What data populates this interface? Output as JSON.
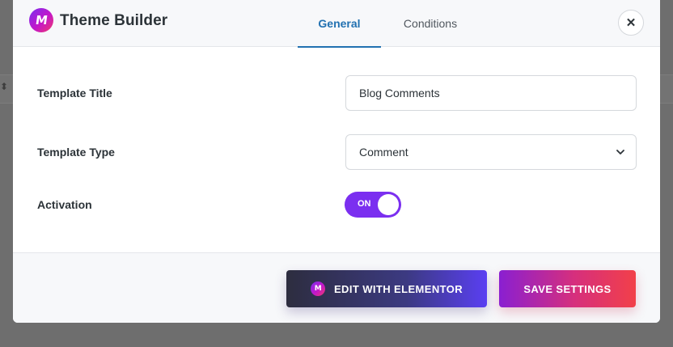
{
  "modal": {
    "title": "Theme Builder",
    "logo_letter": "M",
    "close_symbol": "✕"
  },
  "tabs": [
    {
      "label": "General",
      "active": true
    },
    {
      "label": "Conditions",
      "active": false
    }
  ],
  "form": {
    "template_title": {
      "label": "Template Title",
      "value": "Blog Comments"
    },
    "template_type": {
      "label": "Template Type",
      "selected": "Comment"
    },
    "activation": {
      "label": "Activation",
      "state_text": "ON",
      "enabled": true
    }
  },
  "footer": {
    "edit_label": "EDIT WITH ELEMENTOR",
    "save_label": "SAVE SETTINGS"
  },
  "colors": {
    "accent": "#2271b1",
    "toggle": "#7b2ff0",
    "brand_gradient_start": "#7a2ff0",
    "brand_gradient_end": "#f03a6a"
  },
  "icons": {
    "logo": "brand-logo-icon",
    "close": "close-icon",
    "dropdown": "chevron-down-icon"
  }
}
